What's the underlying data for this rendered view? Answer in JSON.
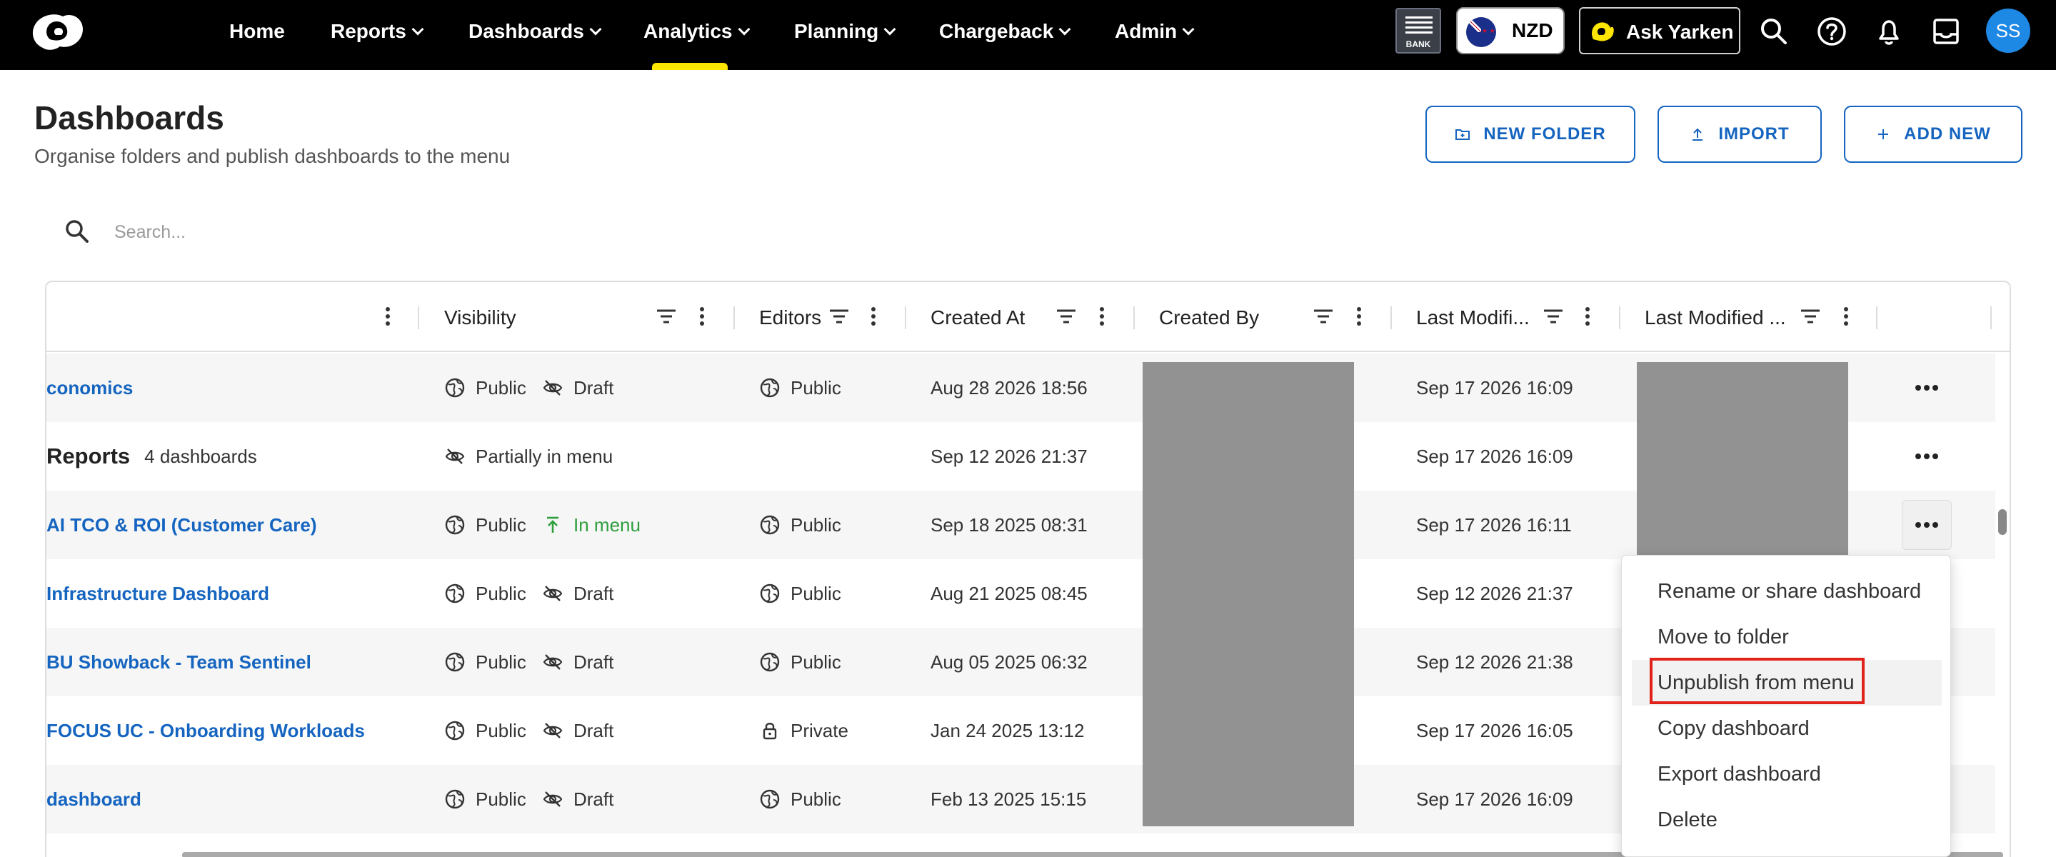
{
  "nav": {
    "items": [
      {
        "label": "Home",
        "has_menu": false
      },
      {
        "label": "Reports",
        "has_menu": true
      },
      {
        "label": "Dashboards",
        "has_menu": true
      },
      {
        "label": "Analytics",
        "has_menu": true,
        "active": true
      },
      {
        "label": "Planning",
        "has_menu": true
      },
      {
        "label": "Chargeback",
        "has_menu": true
      },
      {
        "label": "Admin",
        "has_menu": true
      }
    ],
    "bank_label": "BANK",
    "currency": "NZD",
    "ask_label": "Ask Yarken",
    "avatar_initials": "SS",
    "accent_color": "#ffe600"
  },
  "header": {
    "title": "Dashboards",
    "subtitle": "Organise folders and publish dashboards to the menu",
    "new_folder": "NEW FOLDER",
    "import": "IMPORT",
    "add_new": "ADD NEW"
  },
  "search": {
    "placeholder": "Search..."
  },
  "table": {
    "columns": [
      "Visibility",
      "Editors",
      "Created At",
      "Created By",
      "Last Modifi...",
      "Last Modified ..."
    ],
    "rows": [
      {
        "name": "conomics",
        "type": "dashboard",
        "visibility": "Public",
        "status": "Draft",
        "editors": "Public",
        "editors_icon": "globe-icon",
        "created_at": "Aug 28 2026 18:56",
        "last_modified": "Sep 17 2026 16:09"
      },
      {
        "name": "Reports",
        "type": "folder",
        "count": "4 dashboards",
        "status": "Partially in menu",
        "editors": "",
        "created_at": "Sep 12 2026 21:37",
        "last_modified": "Sep 17 2026 16:09"
      },
      {
        "name": "AI TCO & ROI (Customer Care)",
        "type": "dashboard",
        "visibility": "Public",
        "status": "In menu",
        "editors": "Public",
        "editors_icon": "globe-icon",
        "created_at": "Sep 18 2025 08:31",
        "last_modified": "Sep 17 2026 16:11"
      },
      {
        "name": "Infrastructure Dashboard",
        "type": "dashboard",
        "visibility": "Public",
        "status": "Draft",
        "editors": "Public",
        "editors_icon": "globe-icon",
        "created_at": "Aug 21 2025 08:45",
        "last_modified": "Sep 12 2026 21:37"
      },
      {
        "name": "BU Showback - Team Sentinel",
        "type": "dashboard",
        "visibility": "Public",
        "status": "Draft",
        "editors": "Public",
        "editors_icon": "globe-icon",
        "created_at": "Aug 05 2025 06:32",
        "last_modified": "Sep 12 2026 21:38"
      },
      {
        "name": "FOCUS UC - Onboarding Workloads",
        "type": "dashboard",
        "visibility": "Public",
        "status": "Draft",
        "editors": "Private",
        "editors_icon": "lock-icon",
        "created_at": "Jan 24 2025 13:12",
        "last_modified": "Sep 17 2026 16:05"
      },
      {
        "name": "dashboard",
        "type": "dashboard",
        "visibility": "Public",
        "status": "Draft",
        "editors": "Public",
        "editors_icon": "globe-icon",
        "created_at": "Feb 13 2025 15:15",
        "last_modified": "Sep 17 2026 16:09"
      }
    ]
  },
  "context_menu": {
    "items": [
      "Rename or share dashboard",
      "Move to folder",
      "Unpublish from menu",
      "Copy dashboard",
      "Export dashboard",
      "Delete"
    ],
    "hovered_item": "Unpublish from menu",
    "highlight_color": "#e0221b"
  }
}
